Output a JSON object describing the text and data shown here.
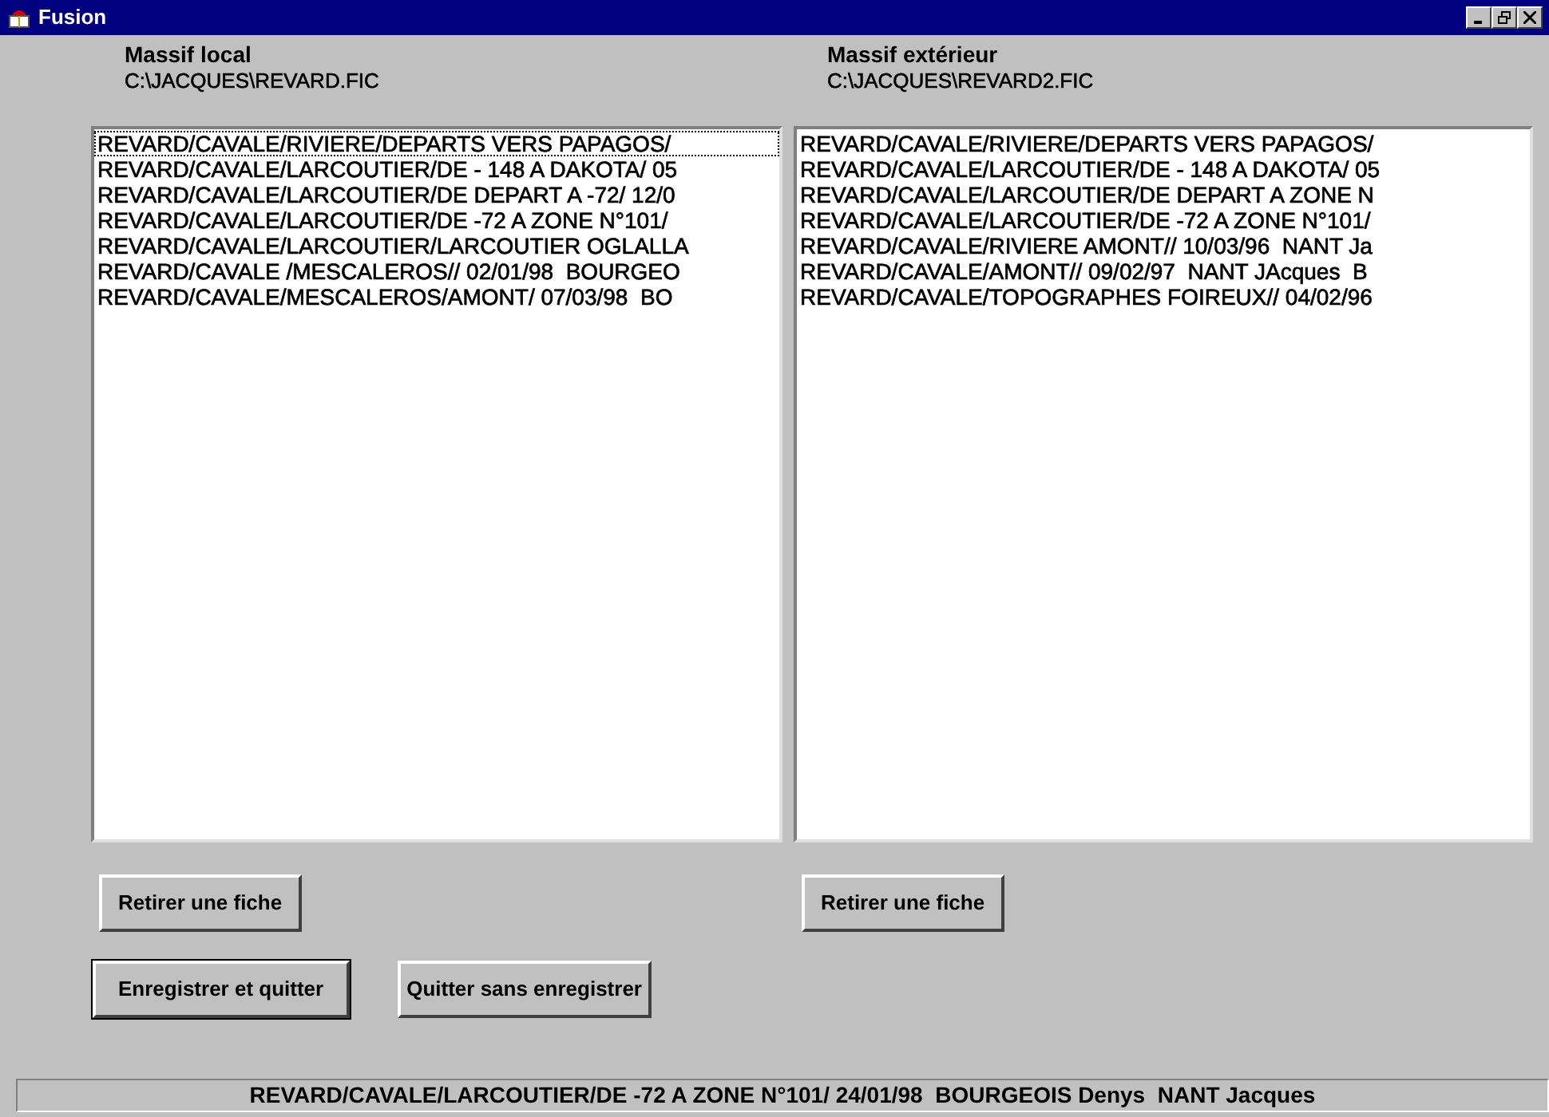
{
  "window": {
    "title": "Fusion"
  },
  "panels": [
    {
      "label": "Massif local",
      "path": "C:\\JACQUES\\REVARD.FIC",
      "items": [
        {
          "text": "REVARD/CAVALE/RIVIERE/DEPARTS VERS PAPAGOS/",
          "selected": true
        },
        {
          "text": "REVARD/CAVALE/LARCOUTIER/DE - 148 A DAKOTA/ 05",
          "selected": false
        },
        {
          "text": "REVARD/CAVALE/LARCOUTIER/DE DEPART A -72/ 12/0",
          "selected": false
        },
        {
          "text": "REVARD/CAVALE/LARCOUTIER/DE -72 A ZONE N°101/",
          "selected": false
        },
        {
          "text": "REVARD/CAVALE/LARCOUTIER/LARCOUTIER OGLALLA",
          "selected": false
        },
        {
          "text": "REVARD/CAVALE /MESCALEROS// 02/01/98  BOURGEO",
          "selected": false
        },
        {
          "text": "REVARD/CAVALE/MESCALEROS/AMONT/ 07/03/98  BO",
          "selected": false
        }
      ],
      "button": "Retirer une fiche"
    },
    {
      "label": "Massif extérieur",
      "path": "C:\\JACQUES\\REVARD2.FIC",
      "items": [
        {
          "text": "REVARD/CAVALE/RIVIERE/DEPARTS VERS PAPAGOS/",
          "selected": false
        },
        {
          "text": "REVARD/CAVALE/LARCOUTIER/DE - 148 A DAKOTA/ 05",
          "selected": false
        },
        {
          "text": "REVARD/CAVALE/LARCOUTIER/DE DEPART A ZONE N",
          "selected": false
        },
        {
          "text": "REVARD/CAVALE/LARCOUTIER/DE -72 A ZONE N°101/",
          "selected": false
        },
        {
          "text": "REVARD/CAVALE/RIVIERE AMONT// 10/03/96  NANT Ja",
          "selected": false
        },
        {
          "text": "REVARD/CAVALE/AMONT// 09/02/97  NANT JAcques  B",
          "selected": false
        },
        {
          "text": "REVARD/CAVALE/TOPOGRAPHES FOIREUX// 04/02/96",
          "selected": false
        }
      ],
      "button": "Retirer une fiche"
    }
  ],
  "actions": [
    {
      "label": "Enregistrer et quitter",
      "default": true
    },
    {
      "label": "Quitter sans enregistrer",
      "default": false
    }
  ],
  "status_bar": "REVARD/CAVALE/LARCOUTIER/DE -72 A ZONE N°101/ 24/01/98  BOURGEOIS Denys  NANT Jacques"
}
